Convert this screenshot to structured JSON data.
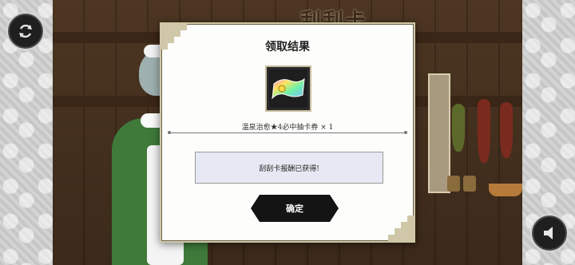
{
  "scene": {
    "background_title": "刮刮卡"
  },
  "buttons": {
    "refresh_icon": "refresh-icon",
    "sound_icon": "speaker-icon"
  },
  "modal": {
    "title": "领取结果",
    "item": {
      "icon": "ticket-icon",
      "name": "温泉治愈★4必中抽卡券 × 1"
    },
    "message": "刮刮卡报酬已获得!",
    "confirm_label": "确定"
  },
  "colors": {
    "modal_bg": "#fdfdfb",
    "message_bg": "#e6e8f3",
    "confirm_bg": "#141414",
    "dress_green": "#3f7a3a"
  }
}
